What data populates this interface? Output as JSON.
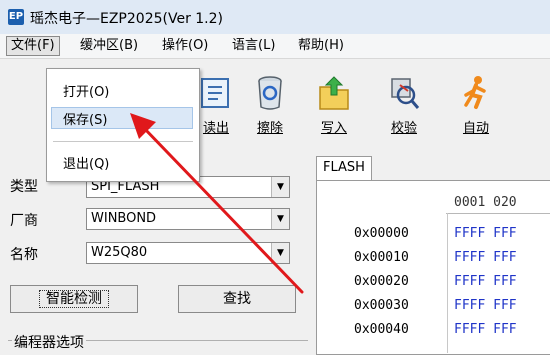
{
  "titlebar": {
    "icon_text": "EP",
    "title": "瑶杰电子—EZP2025(Ver 1.2)"
  },
  "menu": [
    {
      "label": "文件(F)",
      "active": true
    },
    {
      "label": "缓冲区(B)"
    },
    {
      "label": "操作(O)"
    },
    {
      "label": "语言(L)"
    },
    {
      "label": "帮助(H)"
    }
  ],
  "file_menu": {
    "items": [
      "打开(O)",
      "保存(S)",
      "退出(Q)"
    ],
    "highlighted": "保存(S)"
  },
  "toolbar": {
    "read_label_partial": "读出",
    "erase_label": "擦除",
    "write_label": "写入",
    "verify_label": "校验",
    "auto_label": "自动"
  },
  "left_panel": {
    "type_label": "类型",
    "type_value": "SPI_FLASH",
    "vendor_label": "厂商",
    "vendor_value": "WINBOND",
    "name_label": "名称",
    "name_value": "W25Q80",
    "detect_button": "智能检测",
    "find_button": "查找",
    "group_title": "编程器选项"
  },
  "hex_view": {
    "tab": "FLASH",
    "header": "0001 020",
    "rows": [
      {
        "addr": "0x00000",
        "data": "FFFF FFF"
      },
      {
        "addr": "0x00010",
        "data": "FFFF FFF"
      },
      {
        "addr": "0x00020",
        "data": "FFFF FFF"
      },
      {
        "addr": "0x00030",
        "data": "FFFF FFF"
      },
      {
        "addr": "0x00040",
        "data": "FFFF FFF"
      }
    ]
  },
  "colors": {
    "hex_data": "#1f34c8",
    "arrow": "#e0181b",
    "highlight": "#dbe8f7"
  }
}
